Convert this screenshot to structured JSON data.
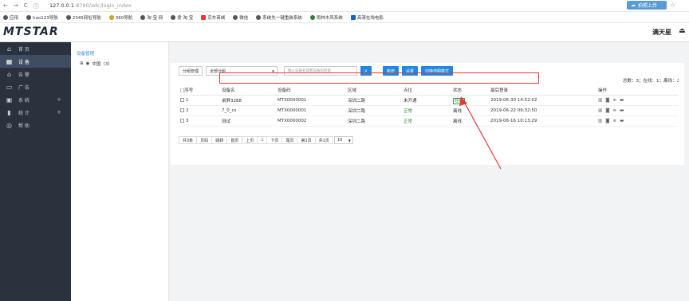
{
  "browser": {
    "back": "←",
    "forward": "→",
    "reload": "C",
    "url_info": "ⓘ",
    "url_host": "127.0.0.1",
    "url_path": ":8780/adc/login_index",
    "upload_label": "拍照上传",
    "star": "☆"
  },
  "bookmarks": [
    "应用",
    "hao123导航",
    "2345网址导航",
    "360导航",
    "淘 宝 网",
    "爱 淘 宝",
    "京东商城",
    "微信",
    "系统先一键重装系统",
    "雨林木风系统",
    "高清在线电影"
  ],
  "header": {
    "logo": "MTSTAR",
    "user": "满天星",
    "logout_icon": "⏏"
  },
  "sidebar": {
    "items": [
      {
        "icon": "⌂",
        "label": "首 页"
      },
      {
        "icon": "▦",
        "label": "设 备"
      },
      {
        "icon": "⌂",
        "label": "告 警"
      },
      {
        "icon": "▭",
        "label": "广 告"
      },
      {
        "icon": "▣",
        "label": "系 统",
        "plus": "+"
      },
      {
        "icon": "▮",
        "label": "统 计",
        "plus": "+"
      },
      {
        "icon": "◎",
        "label": "帮 助"
      }
    ]
  },
  "tree": {
    "title": "设备管理",
    "node_label": "中国（3）"
  },
  "toolbar": {
    "group_label": "分组管理",
    "group_value": "全部分组",
    "search_placeholder": "输入设备名或者设备码检索",
    "add": "新增",
    "settings": "设置",
    "switch_map": "切换地图模式"
  },
  "stats": {
    "total_label": "总数：",
    "total": "3",
    "online_label": "；在线：",
    "online": "1",
    "offline_label": "；离线：",
    "offline": "2"
  },
  "table": {
    "headers": [
      "□序号",
      "设备名",
      "设备码",
      "区域",
      "点位",
      "状态",
      "最后登录",
      "操作"
    ],
    "rows": [
      {
        "no": "1",
        "name": "桌屏3288",
        "code": "MTX0000001",
        "area": "深圳二路",
        "point": "未开通",
        "status": "在线",
        "last": "2019-06-30 14:52:02"
      },
      {
        "no": "2",
        "name": "7_0_cs",
        "code": "MTX0000001",
        "area": "深圳二路",
        "point": "正常",
        "status": "离线",
        "last": "2019-06-22 09:32:50"
      },
      {
        "no": "3",
        "name": "测试",
        "code": "MTX0000002",
        "area": "深圳二路",
        "point": "正常",
        "status": "离线",
        "last": "2019-06-16 10:13:29"
      }
    ]
  },
  "pager": {
    "total": "共3条",
    "page_input": "页码",
    "jump": "跳转",
    "first": "首页",
    "prev": "上页",
    "current": "1",
    "next": "下页",
    "last": "尾页",
    "page_of": "第1页",
    "pages": "共1页",
    "size": "10"
  },
  "colors": {
    "sidebar": "#2b323e",
    "accent": "#1e88e5",
    "highlight": "#e53935"
  }
}
